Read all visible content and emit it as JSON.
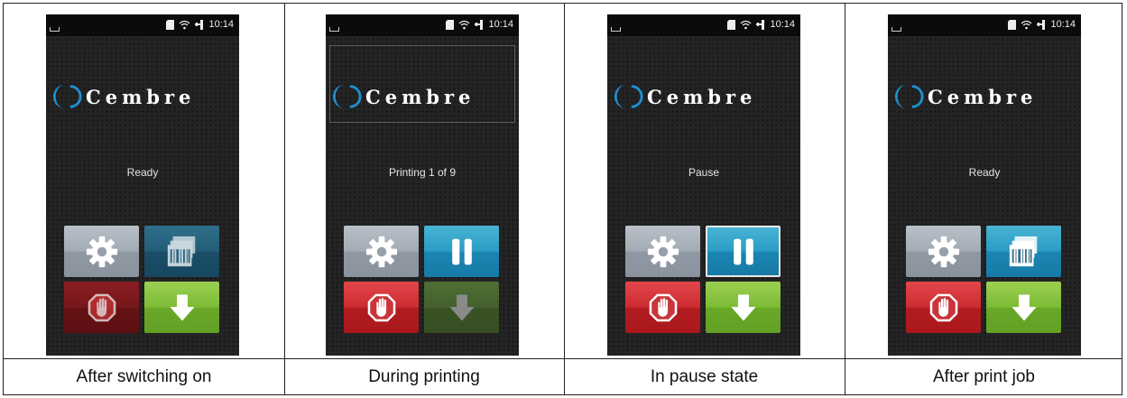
{
  "status_bar": {
    "time": "10:14"
  },
  "brand": {
    "name": "Cembre"
  },
  "panels": [
    {
      "caption": "After switching on",
      "message": "Ready"
    },
    {
      "caption": "During printing",
      "message": "Printing 1 of 9"
    },
    {
      "caption": "In pause state",
      "message": "Pause"
    },
    {
      "caption": "After print job",
      "message": "Ready"
    }
  ],
  "icons": {
    "settings": "gear-icon",
    "labels": "label-stack-icon",
    "pause": "pause-icon",
    "cancel": "stop-hand-icon",
    "feed": "arrow-down-icon",
    "sd_card": "sd-card-icon",
    "wifi": "wifi-icon",
    "network": "ethernet-icon"
  },
  "colors": {
    "brand_blue": "#1e8fd0",
    "button_gray": "#a2aab4",
    "button_blue": "#2a9cc4",
    "button_red": "#cc2b30",
    "button_green": "#7dbb35",
    "screen_bg": "#242424"
  }
}
